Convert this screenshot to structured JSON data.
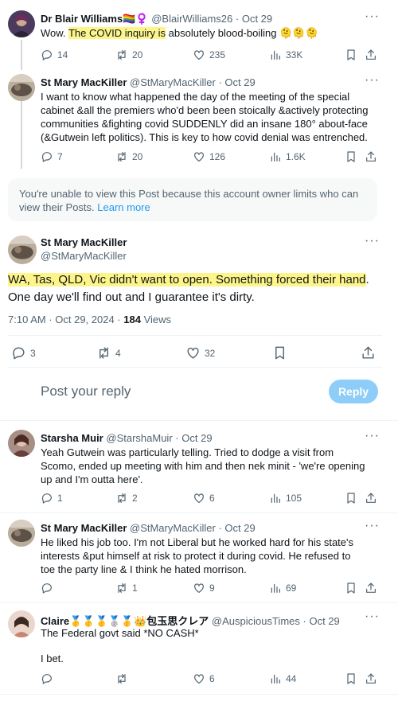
{
  "tweets": [
    {
      "display_name": "Dr Blair Williams",
      "name_emoji": "🏳️‍🌈♀️",
      "handle": "@BlairWilliams26",
      "dot": "·",
      "date": "Oct 29",
      "text_before": "Wow. ",
      "text_highlight": "The COVID inquiry is",
      "text_after": " absolutely blood-boiling 🫠🫠🫠",
      "replies": "14",
      "retweets": "20",
      "likes": "235",
      "views": "33K"
    },
    {
      "display_name": "St Mary MacKiller",
      "handle": "@StMaryMacKiller",
      "dot": "·",
      "date": "Oct 29",
      "text": "I want to know what happened the day of the meeting of the special cabinet &all the premiers who'd been been stoically &actively protecting communities &fighting covid SUDDENLY did an insane 180° about-face (&Gutwein left politics). This is key to how covid denial was entrenched.",
      "replies": "7",
      "retweets": "20",
      "likes": "126",
      "views": "1.6K"
    }
  ],
  "notice": {
    "text": "You're unable to view this Post because this account owner limits who can view their Posts. ",
    "link": "Learn more"
  },
  "main_post": {
    "display_name": "St Mary MacKiller",
    "handle": "@StMaryMacKiller",
    "text_highlight": "WA, Tas, QLD, Vic didn't want to open. Something forced their hand",
    "text_after": ". One day we'll find out and I guarantee it's dirty.",
    "time": "7:10 AM · Oct 29, 2024 · ",
    "views_count": "184",
    "views_label": " Views",
    "replies": "3",
    "retweets": "4",
    "likes": "32"
  },
  "reply_box": {
    "placeholder": "Post your reply",
    "button": "Reply"
  },
  "replies": [
    {
      "display_name": "Starsha Muir",
      "handle": "@StarshaMuir",
      "dot": "·",
      "date": "Oct 29",
      "text": "Yeah Gutwein was particularly telling. Tried to dodge a visit from Scomo, ended up meeting with him and then nek minit - 'we're opening up and I'm outta here'.",
      "replies": "1",
      "retweets": "2",
      "likes": "6",
      "views": "105"
    },
    {
      "display_name": "St Mary MacKiller",
      "handle": "@StMaryMacKiller",
      "dot": "·",
      "date": "Oct 29",
      "text": "He liked his job too. I'm not Liberal but he worked hard for his state's interests &put himself at risk to protect it during covid. He refused to toe the party line & I think he hated morrison.",
      "replies": "",
      "retweets": "1",
      "likes": "9",
      "views": "69"
    },
    {
      "display_name": "Claire",
      "name_emoji": "🥇🥇🥇🥈🥇👑",
      "name_cjk": "包玉思クレア",
      "handle": "@AuspiciousTimes",
      "dot": "·",
      "date": "Oct 29",
      "text_line1": "The Federal govt said *NO CASH*",
      "text_line2": "I bet.",
      "replies": "",
      "retweets": "",
      "likes": "6",
      "views": "44"
    }
  ],
  "icons": {
    "reply": "reply-icon",
    "retweet": "retweet-icon",
    "like": "heart-icon",
    "views": "views-icon",
    "bookmark": "bookmark-icon",
    "share": "share-icon",
    "more": "more-icon"
  },
  "colors": {
    "accent": "#1d9bf0",
    "highlight": "#fdf58a",
    "muted": "#536471"
  }
}
